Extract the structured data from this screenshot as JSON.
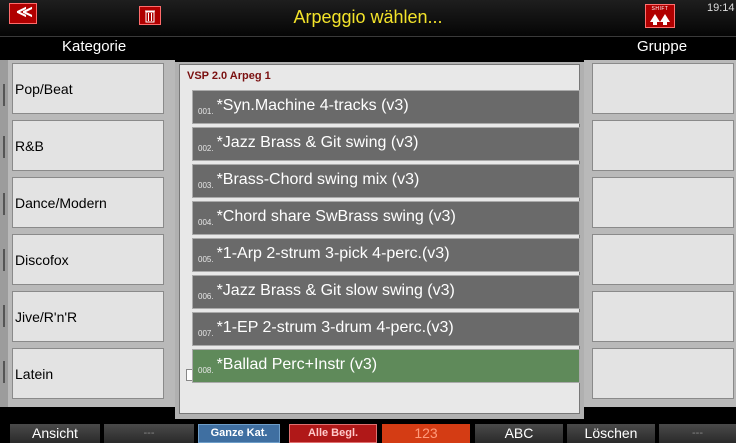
{
  "header": {
    "title": "Arpeggio wählen...",
    "back_symbol": "≪",
    "shift_label": "SHIFT",
    "clock": "19:14"
  },
  "columns": {
    "category_label": "Kategorie",
    "group_label": "Gruppe"
  },
  "categories": [
    "Pop/Beat",
    "R&B",
    "Dance/Modern",
    "Discofox",
    "Jive/R'n'R",
    "Latein"
  ],
  "list": {
    "title": "VSP 2.0 Arpeg 1",
    "items": [
      {
        "num": "001.",
        "name": "*Syn.Machine 4-tracks (v3)"
      },
      {
        "num": "002.",
        "name": "*Jazz Brass & Git swing (v3)"
      },
      {
        "num": "003.",
        "name": "*Brass-Chord swing mix (v3)"
      },
      {
        "num": "004.",
        "name": "*Chord share SwBrass swing (v3)"
      },
      {
        "num": "005.",
        "name": "*1-Arp 2-strum 3-pick 4-perc.(v3)"
      },
      {
        "num": "006.",
        "name": "*Jazz Brass & Git slow swing (v3)"
      },
      {
        "num": "007.",
        "name": "*1-EP 2-strum 3-drum 4-perc.(v3)"
      },
      {
        "num": "008.",
        "name": "*Ballad Perc+Instr (v3)"
      }
    ],
    "selected_index": 7
  },
  "bottom": {
    "ansicht": "Ansicht",
    "dash1": "---",
    "ganze": "Ganze Kat.",
    "alle": "Alle Begl.",
    "n123": "123",
    "abc": "ABC",
    "loeschen": "Löschen",
    "dash2": "---"
  },
  "colors": {
    "title": "#f3e32a",
    "selected_item": "#5f8a5a",
    "item": "#6a6a6a",
    "accent_red": "#b00000"
  }
}
